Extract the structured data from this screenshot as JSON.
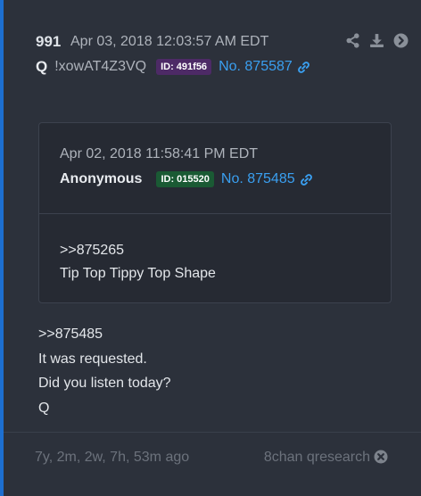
{
  "post": {
    "number": "991",
    "date": "Apr 03, 2018 12:03:57 AM EDT",
    "author": "Q",
    "tripcode": "!xowAT4Z3VQ",
    "id_badge": "ID: 491f56",
    "post_link": "No. 875587",
    "actions": [
      "share-icon",
      "download-icon",
      "arrow-right-circle-icon"
    ],
    "body_lines": [
      "It was requested.",
      "Did you listen today?",
      "Q"
    ],
    "reply_ref": ">>875485"
  },
  "quoted": {
    "date": "Apr 02, 2018 11:58:41 PM EDT",
    "author": "Anonymous",
    "id_badge": "ID: 015520",
    "post_link": "No. 875485",
    "reply_ref": ">>875265",
    "body_lines": [
      "Tip Top Tippy Top Shape"
    ]
  },
  "footer": {
    "ago": "7y, 2m, 2w, 7h, 53m ago",
    "source": "8chan qresearch"
  },
  "colors": {
    "accent_border": "#1d6fd0",
    "link": "#3a9ff0",
    "badge_purple": "#4d2a66",
    "badge_green": "#1a5a34"
  }
}
